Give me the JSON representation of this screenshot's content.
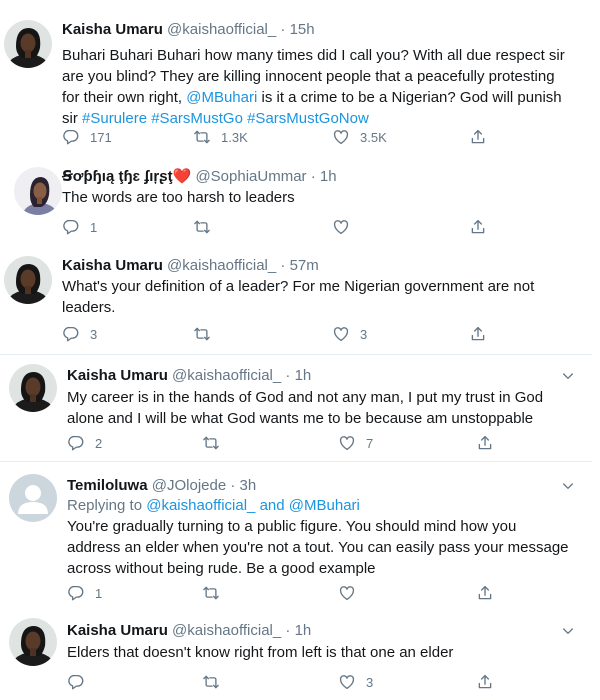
{
  "tweets": [
    {
      "name": "Kaisha Umaru",
      "handle": "@kaishaofficial_",
      "dot": "·",
      "time": "15h",
      "text_segments": [
        {
          "t": "Buhari Buhari Buhari how many times did I call you? With all due respect sir are you blind? They are killing innocent people that a peacefully protesting for their own right, "
        },
        {
          "t": "@MBuhari",
          "link": true
        },
        {
          "t": " is it a crime to be a Nigerian? God will punish sir "
        },
        {
          "t": "#Surulere",
          "link": true
        },
        {
          "t": " "
        },
        {
          "t": "#SarsMustGo",
          "link": true
        },
        {
          "t": " "
        },
        {
          "t": "#SarsMustGoNow",
          "link": true
        }
      ],
      "replies": "171",
      "retweets": "1.3K",
      "likes": "3.5K"
    },
    {
      "name": "Ꞩơƥɧıą ţɧɛ ʄıŗʂţ",
      "heart": "❤️",
      "handle": "@SophiaUmmar",
      "dot": "·",
      "time": "1h",
      "text": "The words are too harsh to leaders",
      "replies": "1",
      "retweets": "",
      "likes": ""
    },
    {
      "name": "Kaisha Umaru",
      "handle": "@kaishaofficial_",
      "dot": "·",
      "time": "57m",
      "text": "What's your definition of a leader?  For me Nigerian government are not leaders.",
      "replies": "3",
      "retweets": "",
      "likes": "3"
    },
    {
      "name": "Kaisha Umaru",
      "handle": "@kaishaofficial_",
      "dot": "·",
      "time": "1h",
      "text": "My career is in the hands of God and not any man, I put my trust in God alone and I will be what God wants me to be because am unstoppable",
      "replies": "2",
      "retweets": "",
      "likes": "7"
    },
    {
      "name": "Temiloluwa",
      "handle": "@JOlojede",
      "dot": "·",
      "time": "3h",
      "replying_prefix": "Replying to",
      "replying_user1": "@kaishaofficial_",
      "replying_and": "and",
      "replying_user2": "@MBuhari",
      "text": "You're gradually turning to a public figure. You should mind how you address an elder when you're not a tout. You can easily pass your message across without being rude. Be a good example",
      "replies": "1",
      "retweets": "",
      "likes": ""
    },
    {
      "name": "Kaisha Umaru",
      "handle": "@kaishaofficial_",
      "dot": "·",
      "time": "1h",
      "text": "Elders that doesn't know right from left is that one an elder",
      "replies": "",
      "retweets": "",
      "likes": "3"
    }
  ],
  "colors": {
    "link": "#1b95e0",
    "muted": "#657786",
    "text": "#14171a",
    "separator": "#e6ecf0"
  },
  "icons": [
    "reply-icon",
    "retweet-icon",
    "like-icon",
    "share-icon",
    "chevron-down-icon"
  ]
}
